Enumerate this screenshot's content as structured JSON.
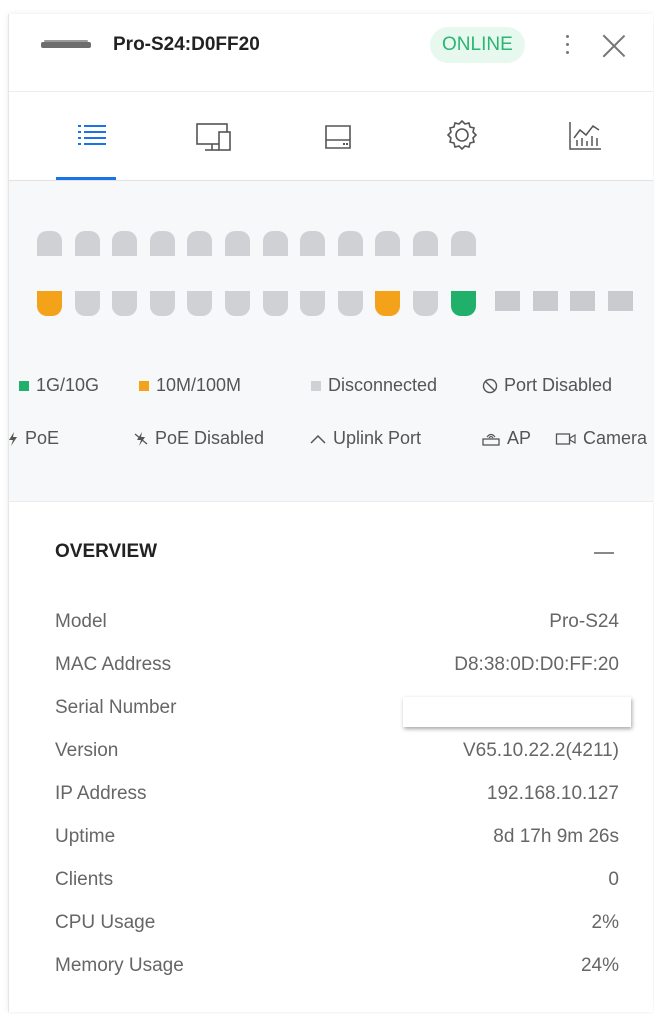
{
  "header": {
    "device_name": "Pro-S24:D0FF20",
    "status": "ONLINE",
    "status_color": "#2bb673"
  },
  "tabs": [
    {
      "name": "overview",
      "icon": "list-icon",
      "active": true
    },
    {
      "name": "clients",
      "icon": "devices-icon",
      "active": false
    },
    {
      "name": "ports",
      "icon": "drive-icon",
      "active": false
    },
    {
      "name": "settings",
      "icon": "gear-icon",
      "active": false
    },
    {
      "name": "statistics",
      "icon": "chart-icon",
      "active": false
    }
  ],
  "colors": {
    "accent": "#1a73e8",
    "gigabit": "#21b06a",
    "fast": "#f5a21b",
    "disconnected": "#cfd1d4",
    "sfp": "#c9cbcf"
  },
  "ports": {
    "top_row": [
      "disconnected",
      "disconnected",
      "disconnected",
      "disconnected",
      "disconnected",
      "disconnected",
      "disconnected",
      "disconnected",
      "disconnected",
      "disconnected",
      "disconnected",
      "disconnected"
    ],
    "bottom_row": [
      "fast",
      "disconnected",
      "disconnected",
      "disconnected",
      "disconnected",
      "disconnected",
      "disconnected",
      "disconnected",
      "disconnected",
      "fast",
      "disconnected",
      "gigabit"
    ],
    "sfp_row": [
      "disconnected",
      "disconnected",
      "disconnected",
      "disconnected"
    ]
  },
  "legend": {
    "gigabit": "1G/10G",
    "fast": "10M/100M",
    "disconnected": "Disconnected",
    "port_disabled": "Port Disabled",
    "poe": "PoE",
    "poe_disabled": "PoE Disabled",
    "uplink": "Uplink Port",
    "ap": "AP",
    "camera": "Camera"
  },
  "overview": {
    "title": "OVERVIEW",
    "rows": [
      {
        "label": "Model",
        "value": "Pro-S24"
      },
      {
        "label": "MAC Address",
        "value": "D8:38:0D:D0:FF:20"
      },
      {
        "label": "Serial Number",
        "value": ""
      },
      {
        "label": "Version",
        "value": "V65.10.22.2(4211)"
      },
      {
        "label": "IP Address",
        "value": "192.168.10.127"
      },
      {
        "label": "Uptime",
        "value": "8d 17h 9m 26s"
      },
      {
        "label": "Clients",
        "value": "0"
      },
      {
        "label": "CPU Usage",
        "value": "2%"
      },
      {
        "label": "Memory Usage",
        "value": "24%"
      }
    ]
  }
}
